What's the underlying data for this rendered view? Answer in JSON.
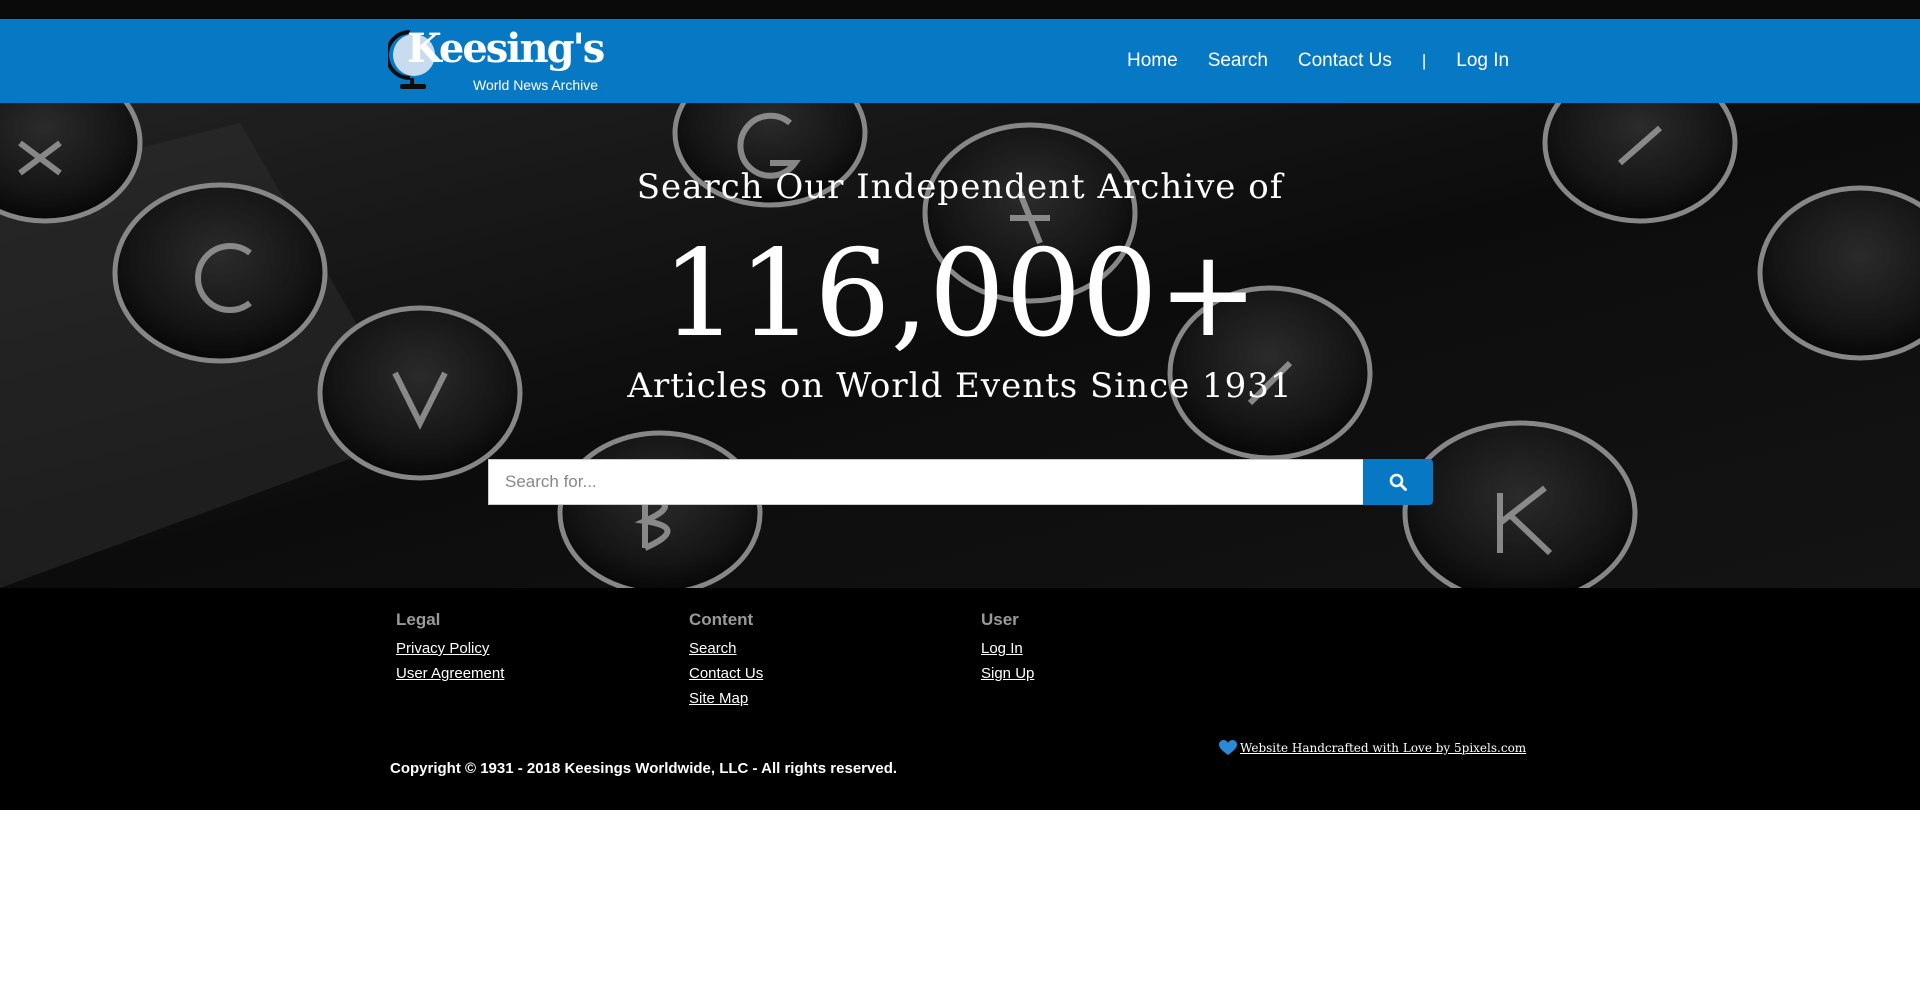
{
  "brand": {
    "name": "Keesing's",
    "tagline": "World News Archive"
  },
  "nav": {
    "home": "Home",
    "search": "Search",
    "contact": "Contact Us",
    "separator": "|",
    "login": "Log In"
  },
  "hero": {
    "line1": "Search Our Independent Archive of",
    "count": "116,000+",
    "line3": "Articles on World Events Since 1931",
    "search_placeholder": "Search for..."
  },
  "footer": {
    "legal": {
      "heading": "Legal",
      "links": [
        "Privacy Policy",
        "User Agreement"
      ]
    },
    "content": {
      "heading": "Content",
      "links": [
        "Search",
        "Contact Us",
        "Site Map"
      ]
    },
    "user": {
      "heading": "User",
      "links": [
        "Log In",
        "Sign Up"
      ]
    },
    "credit": "Website Handcrafted with Love by 5pixels.com",
    "copyright": "Copyright © 1931 - 2018 Keesings Worldwide, LLC - All rights reserved."
  },
  "colors": {
    "brand_blue": "#0678c4",
    "top_strip": "#0a0a0a",
    "footer_bg": "#000000",
    "footer_heading": "#9a9a9a"
  },
  "icons": {
    "logo": "globe-icon",
    "search_button": "search-icon",
    "credit": "heart-icon"
  }
}
